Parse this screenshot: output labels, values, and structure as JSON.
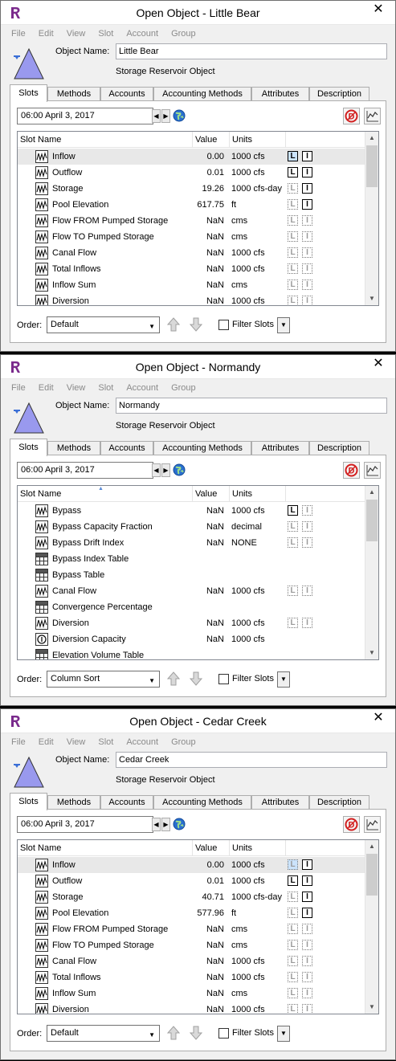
{
  "windows": [
    {
      "title": "Open Object - Little Bear",
      "close_glyph": "✕",
      "menu": [
        "File",
        "Edit",
        "View",
        "Slot",
        "Account",
        "Group"
      ],
      "object_name_label": "Object Name:",
      "object_name": "Little Bear",
      "object_type": "Storage Reservoir Object",
      "tabs": [
        "Slots",
        "Methods",
        "Accounts",
        "Accounting Methods",
        "Attributes",
        "Description"
      ],
      "active_tab": "Slots",
      "timestep": "06:00 April 3, 2017",
      "columns": {
        "name": "Slot Name",
        "value": "Value",
        "units": "Units"
      },
      "sorted_by_name": false,
      "rows": [
        {
          "name": "Inflow",
          "icon": "series-slot-icon",
          "value": "0.00",
          "units": "1000 cfs",
          "flags": [
            true,
            true
          ],
          "selected": true
        },
        {
          "name": "Outflow",
          "icon": "series-slot-icon",
          "value": "0.01",
          "units": "1000 cfs",
          "flags": [
            true,
            true
          ],
          "selected": false
        },
        {
          "name": "Storage",
          "icon": "series-slot-icon",
          "value": "19.26",
          "units": "1000 cfs-day",
          "flags": [
            false,
            true
          ],
          "selected": false
        },
        {
          "name": "Pool Elevation",
          "icon": "series-slot-icon",
          "value": "617.75",
          "units": "ft",
          "flags": [
            false,
            true
          ],
          "selected": false
        },
        {
          "name": "Flow FROM Pumped Storage",
          "icon": "series-slot-icon",
          "value": "NaN",
          "units": "cms",
          "flags": [
            false,
            false
          ],
          "selected": false
        },
        {
          "name": "Flow TO Pumped Storage",
          "icon": "series-slot-icon",
          "value": "NaN",
          "units": "cms",
          "flags": [
            false,
            false
          ],
          "selected": false
        },
        {
          "name": "Canal Flow",
          "icon": "series-slot-icon",
          "value": "NaN",
          "units": "1000 cfs",
          "flags": [
            false,
            false
          ],
          "selected": false
        },
        {
          "name": "Total Inflows",
          "icon": "series-slot-icon",
          "value": "NaN",
          "units": "1000 cfs",
          "flags": [
            false,
            false
          ],
          "selected": false
        },
        {
          "name": "Inflow Sum",
          "icon": "series-slot-icon",
          "value": "NaN",
          "units": "cms",
          "flags": [
            false,
            false
          ],
          "selected": false
        },
        {
          "name": "Diversion",
          "icon": "series-slot-icon",
          "value": "NaN",
          "units": "1000 cfs",
          "flags": [
            false,
            false
          ],
          "selected": false
        }
      ],
      "order_label": "Order:",
      "order_value": "Default",
      "filter_label": "Filter Slots"
    },
    {
      "title": "Open Object - Normandy",
      "close_glyph": "✕",
      "menu": [
        "File",
        "Edit",
        "View",
        "Slot",
        "Account",
        "Group"
      ],
      "object_name_label": "Object Name:",
      "object_name": "Normandy",
      "object_type": "Storage Reservoir Object",
      "tabs": [
        "Slots",
        "Methods",
        "Accounts",
        "Accounting Methods",
        "Attributes",
        "Description"
      ],
      "active_tab": "Slots",
      "timestep": "06:00 April 3, 2017",
      "columns": {
        "name": "Slot Name",
        "value": "Value",
        "units": "Units"
      },
      "sorted_by_name": true,
      "rows": [
        {
          "name": "Bypass",
          "icon": "series-slot-icon",
          "value": "NaN",
          "units": "1000 cfs",
          "flags": [
            true,
            false
          ],
          "selected": false
        },
        {
          "name": "Bypass Capacity Fraction",
          "icon": "series-slot-icon",
          "value": "NaN",
          "units": "decimal",
          "flags": [
            false,
            false
          ],
          "selected": false
        },
        {
          "name": "Bypass Drift Index",
          "icon": "series-slot-icon",
          "value": "NaN",
          "units": "NONE",
          "flags": [
            false,
            false
          ],
          "selected": false
        },
        {
          "name": "Bypass Index Table",
          "icon": "table-slot-icon",
          "value": "",
          "units": "",
          "flags": [],
          "selected": false
        },
        {
          "name": "Bypass Table",
          "icon": "table-slot-icon",
          "value": "",
          "units": "",
          "flags": [],
          "selected": false
        },
        {
          "name": "Canal Flow",
          "icon": "series-slot-icon",
          "value": "NaN",
          "units": "1000 cfs",
          "flags": [
            false,
            false
          ],
          "selected": false
        },
        {
          "name": "Convergence Percentage",
          "icon": "table-slot-icon",
          "value": "",
          "units": "",
          "flags": [],
          "selected": false
        },
        {
          "name": "Diversion",
          "icon": "series-slot-icon",
          "value": "NaN",
          "units": "1000 cfs",
          "flags": [
            false,
            false
          ],
          "selected": false
        },
        {
          "name": "Diversion Capacity",
          "icon": "scalar-slot-icon",
          "value": "NaN",
          "units": "1000 cfs",
          "flags": [],
          "selected": false
        },
        {
          "name": "Elevation Volume Table",
          "icon": "table-slot-icon",
          "value": "",
          "units": "",
          "flags": [],
          "selected": false
        }
      ],
      "order_label": "Order:",
      "order_value": "Column Sort",
      "filter_label": "Filter Slots"
    },
    {
      "title": "Open Object - Cedar Creek",
      "close_glyph": "✕",
      "menu": [
        "File",
        "Edit",
        "View",
        "Slot",
        "Account",
        "Group"
      ],
      "object_name_label": "Object Name:",
      "object_name": "Cedar Creek",
      "object_type": "Storage Reservoir Object",
      "tabs": [
        "Slots",
        "Methods",
        "Accounts",
        "Accounting Methods",
        "Attributes",
        "Description"
      ],
      "active_tab": "Slots",
      "timestep": "06:00 April 3, 2017",
      "columns": {
        "name": "Slot Name",
        "value": "Value",
        "units": "Units"
      },
      "sorted_by_name": false,
      "rows": [
        {
          "name": "Inflow",
          "icon": "series-slot-icon",
          "value": "0.00",
          "units": "1000 cfs",
          "flags": [
            false,
            true
          ],
          "selected": true
        },
        {
          "name": "Outflow",
          "icon": "series-slot-icon",
          "value": "0.01",
          "units": "1000 cfs",
          "flags": [
            true,
            true
          ],
          "selected": false
        },
        {
          "name": "Storage",
          "icon": "series-slot-icon",
          "value": "40.71",
          "units": "1000 cfs-day",
          "flags": [
            false,
            true
          ],
          "selected": false
        },
        {
          "name": "Pool Elevation",
          "icon": "series-slot-icon",
          "value": "577.96",
          "units": "ft",
          "flags": [
            false,
            true
          ],
          "selected": false
        },
        {
          "name": "Flow FROM Pumped Storage",
          "icon": "series-slot-icon",
          "value": "NaN",
          "units": "cms",
          "flags": [
            false,
            false
          ],
          "selected": false
        },
        {
          "name": "Flow TO Pumped Storage",
          "icon": "series-slot-icon",
          "value": "NaN",
          "units": "cms",
          "flags": [
            false,
            false
          ],
          "selected": false
        },
        {
          "name": "Canal Flow",
          "icon": "series-slot-icon",
          "value": "NaN",
          "units": "1000 cfs",
          "flags": [
            false,
            false
          ],
          "selected": false
        },
        {
          "name": "Total Inflows",
          "icon": "series-slot-icon",
          "value": "NaN",
          "units": "1000 cfs",
          "flags": [
            false,
            false
          ],
          "selected": false
        },
        {
          "name": "Inflow Sum",
          "icon": "series-slot-icon",
          "value": "NaN",
          "units": "cms",
          "flags": [
            false,
            false
          ],
          "selected": false
        },
        {
          "name": "Diversion",
          "icon": "series-slot-icon",
          "value": "NaN",
          "units": "1000 cfs",
          "flags": [
            false,
            false
          ],
          "selected": false
        }
      ],
      "order_label": "Order:",
      "order_value": "Default",
      "filter_label": "Filter Slots"
    }
  ],
  "flag_letters": [
    "L",
    "I"
  ],
  "colors": {
    "reservoir_fill": "#9999ee",
    "accent": "#3b6fd6",
    "selection": "#e8e8e8"
  }
}
